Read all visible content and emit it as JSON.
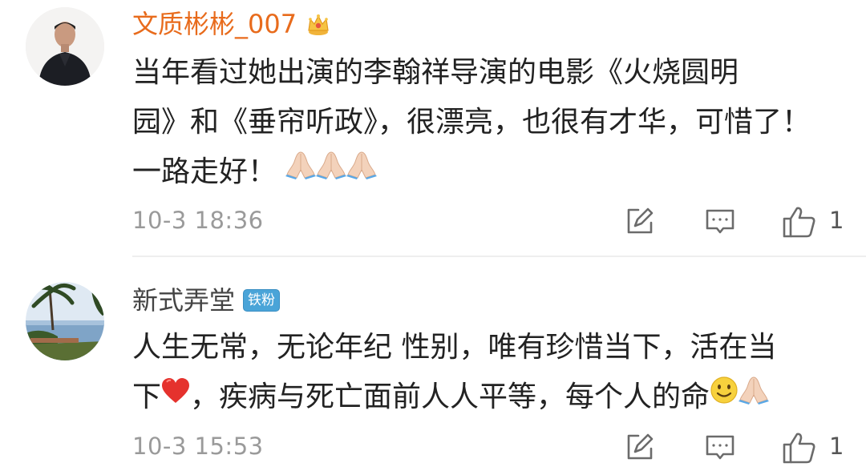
{
  "comments": [
    {
      "username": "文质彬彬_007",
      "text_line1": "当年看过她出演的李翰祥导演的电影《火烧圆明",
      "text_line2": "园》和《垂帘听政》，很漂亮，也很有才华，可惜了！",
      "text_line3": "一路走好！",
      "emoji_suffix": [
        "pray-emoji",
        "pray-emoji",
        "pray-emoji"
      ],
      "time": "10-3 18:36",
      "like_count": "1",
      "username_color": "#e86b1c",
      "badge_icon": "crown-icon"
    },
    {
      "username": "新式弄堂",
      "badge_text": "铁粉",
      "text_line1": "人生无常，无论年纪 性别，唯有珍惜当下，活在当",
      "text_line2_a": "下",
      "text_line2_b": "，疾病与死亡面前人人平等，每个人的命",
      "emojis": [
        "heart-emoji",
        "smile-emoji",
        "pray-emoji"
      ],
      "time": "10-3 15:53",
      "like_count": "1",
      "badge_color": "#4aa4d8"
    }
  ],
  "icons": {
    "repost": "repost-icon",
    "reply": "reply-icon",
    "like": "thumbs-up-icon"
  }
}
